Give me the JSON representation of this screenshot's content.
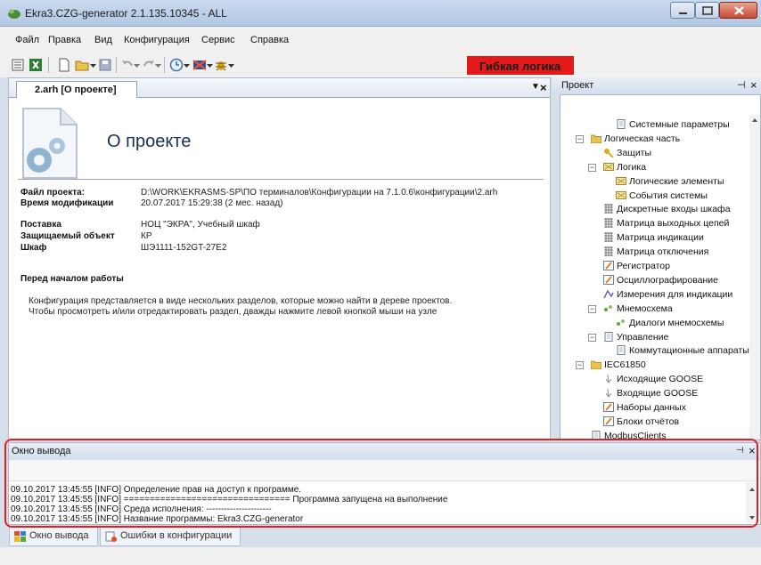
{
  "window": {
    "title": "Ekra3.CZG-generator 2.1.135.10345 - ALL"
  },
  "menu": [
    "Файл",
    "Правка",
    "Вид",
    "Конфигурация",
    "Сервис",
    "Справка"
  ],
  "toolbar": {
    "flex_logic_label": "Гибкая логика"
  },
  "document": {
    "tab_label": "2.arh [О проекте]",
    "heading": "О проекте",
    "fields": [
      {
        "label": "Файл проекта:",
        "value": "D:\\WORK\\EKRASMS-SP\\ПО терминалов\\Конфигурации на 7.1.0.6\\конфигурации\\2.arh"
      },
      {
        "label": "Время модификации",
        "value": "20.07.2017 15:29:38 (2 мес. назад)"
      },
      {
        "label": "Поставка",
        "value": "НОЦ \"ЭКРА\", Учебный шкаф"
      },
      {
        "label": "Защищаемый объект",
        "value": "КР"
      },
      {
        "label": "Шкаф",
        "value": "ШЭ1111-152GT-27E2"
      }
    ],
    "before_start_title": "Перед началом работы",
    "info_lines": [
      "Конфигурация представляется в виде нескольких разделов, которые можно найти в дереве проектов.",
      "Чтобы просмотреть и/или отредактировать раздел, дважды нажмите левой кнопкой мыши на узле"
    ]
  },
  "project": {
    "title": "Проект",
    "tree": [
      {
        "label": "Системные параметры",
        "indent": 3,
        "icon": "page-icon"
      },
      {
        "label": "Логическая часть",
        "indent": 1,
        "icon": "folder-icon",
        "expander": "−"
      },
      {
        "label": "Защиты",
        "indent": 2,
        "icon": "key-icon"
      },
      {
        "label": "Логика",
        "indent": 2,
        "icon": "logic-icon",
        "expander": "−"
      },
      {
        "label": "Логические элементы",
        "indent": 3,
        "icon": "logic-icon"
      },
      {
        "label": "События системы",
        "indent": 3,
        "icon": "logic-icon"
      },
      {
        "label": "Дискретные входы шкафа",
        "indent": 2,
        "icon": "matrix-icon"
      },
      {
        "label": "Матрица выходных цепей",
        "indent": 2,
        "icon": "matrix-icon"
      },
      {
        "label": "Матрица индикации",
        "indent": 2,
        "icon": "matrix-icon"
      },
      {
        "label": "Матрица отключения",
        "indent": 2,
        "icon": "matrix-icon"
      },
      {
        "label": "Регистратор",
        "indent": 2,
        "icon": "edit-icon"
      },
      {
        "label": "Осциллографирование",
        "indent": 2,
        "icon": "edit-icon"
      },
      {
        "label": "Измерения для индикации",
        "indent": 2,
        "icon": "measure-icon"
      },
      {
        "label": "Мнемосхема",
        "indent": 2,
        "icon": "mnemo-icon",
        "expander": "−"
      },
      {
        "label": "Диалоги мнемосхемы",
        "indent": 3,
        "icon": "mnemo-icon"
      },
      {
        "label": "Управление",
        "indent": 2,
        "icon": "page-icon",
        "expander": "−"
      },
      {
        "label": "Коммутационные аппараты",
        "indent": 3,
        "icon": "page-icon"
      },
      {
        "label": "IEC61850",
        "indent": 1,
        "icon": "folder-icon",
        "expander": "−"
      },
      {
        "label": "Исходящие GOOSE",
        "indent": 2,
        "icon": "goose-icon"
      },
      {
        "label": "Входящие GOOSE",
        "indent": 2,
        "icon": "goose-icon"
      },
      {
        "label": "Наборы данных",
        "indent": 2,
        "icon": "edit-icon"
      },
      {
        "label": "Блоки отчётов",
        "indent": 2,
        "icon": "edit-icon"
      },
      {
        "label": "ModbusClients",
        "indent": 1,
        "icon": "page-icon"
      }
    ]
  },
  "output": {
    "title": "Окно вывода",
    "lines": [
      "09.10.2017 13:45:55 [INFO] Определение прав на доступ к программе.",
      "09.10.2017 13:45:55 [INFO] ================================ Программа запущена на выполнение",
      "09.10.2017 13:45:55 [INFO] Среда исполнения: ----------------------",
      "09.10.2017 13:45:55 [INFO] Название программы: Ekra3.CZG-generator"
    ]
  },
  "bottom_tabs": [
    "Окно вывода",
    "Ошибки в конфигурации"
  ],
  "colors": {
    "accent_red": "#e21a1a",
    "outline_red": "#e02020",
    "window_frame": "#b3c8e4"
  }
}
